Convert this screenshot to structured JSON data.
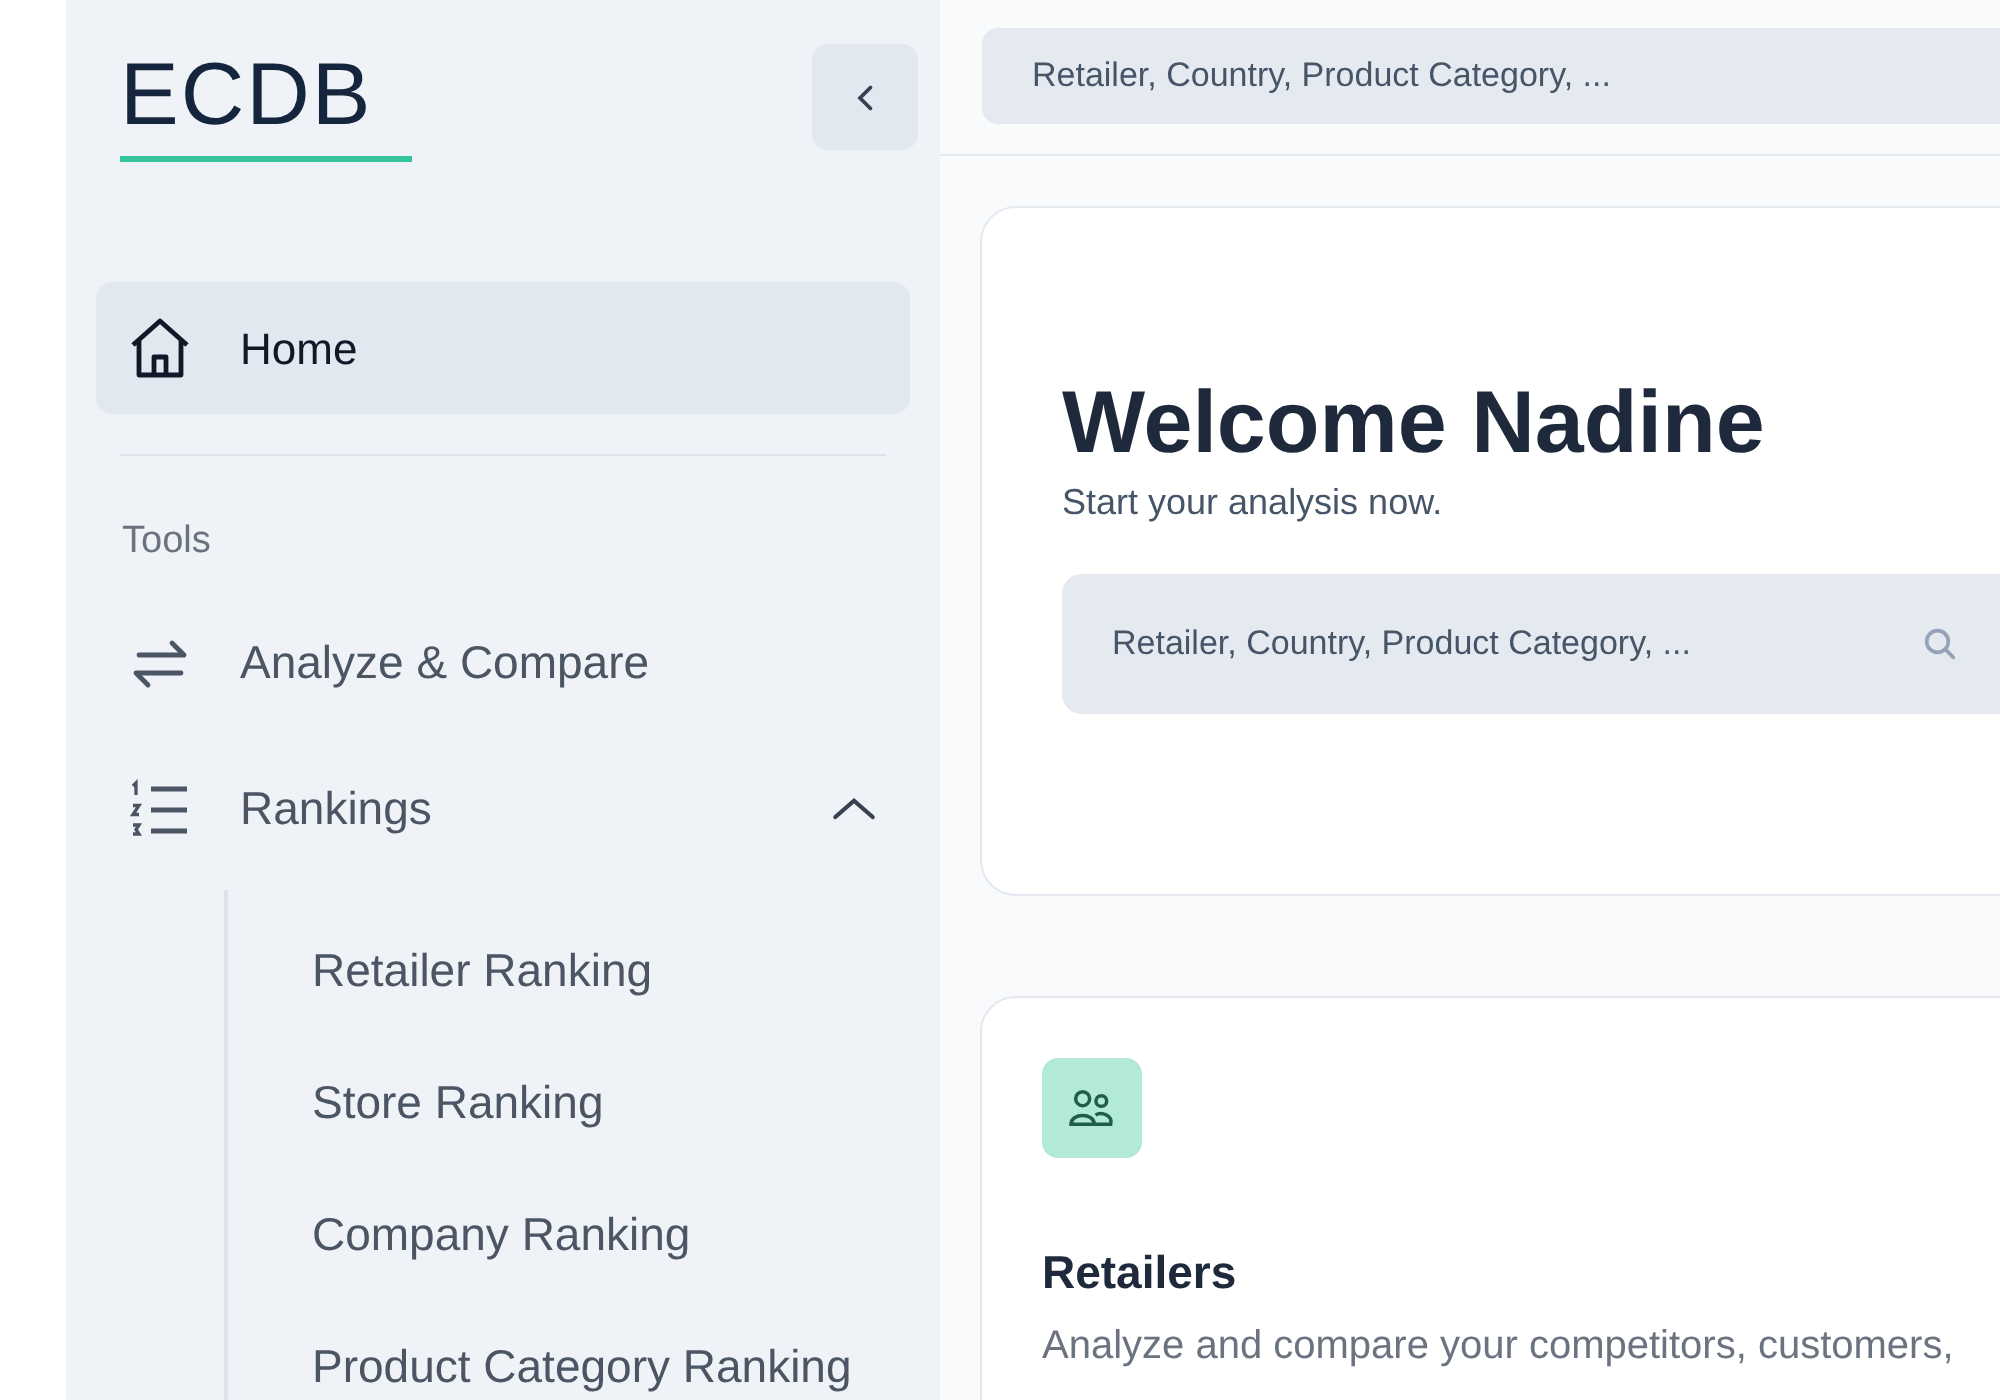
{
  "sidebar": {
    "logo": "ECDB",
    "nav": [
      {
        "kind": "home",
        "label": "Home",
        "selected": true
      }
    ],
    "sections": [
      {
        "title": "Tools",
        "items": [
          {
            "kind": "swap",
            "label": "Analyze & Compare",
            "selected": false
          },
          {
            "kind": "list",
            "label": "Rankings",
            "selected": false,
            "expanded": true,
            "children": [
              {
                "label": "Retailer Ranking",
                "selected": false
              },
              {
                "label": "Store Ranking",
                "selected": false
              },
              {
                "label": "Company Ranking",
                "selected": false
              },
              {
                "label": "Product Category Ranking",
                "selected": false
              }
            ]
          }
        ]
      }
    ]
  },
  "top_search": {
    "placeholder": "Retailer, Country, Product Category, ..."
  },
  "welcome": {
    "title": "Welcome Nadine",
    "subtitle": "Start your analysis now.",
    "search": {
      "placeholder": "Retailer, Country, Product Category, ..."
    }
  },
  "cards": [
    {
      "title": "Retailers",
      "description": "Analyze and compare your competitors, customers,"
    }
  ]
}
